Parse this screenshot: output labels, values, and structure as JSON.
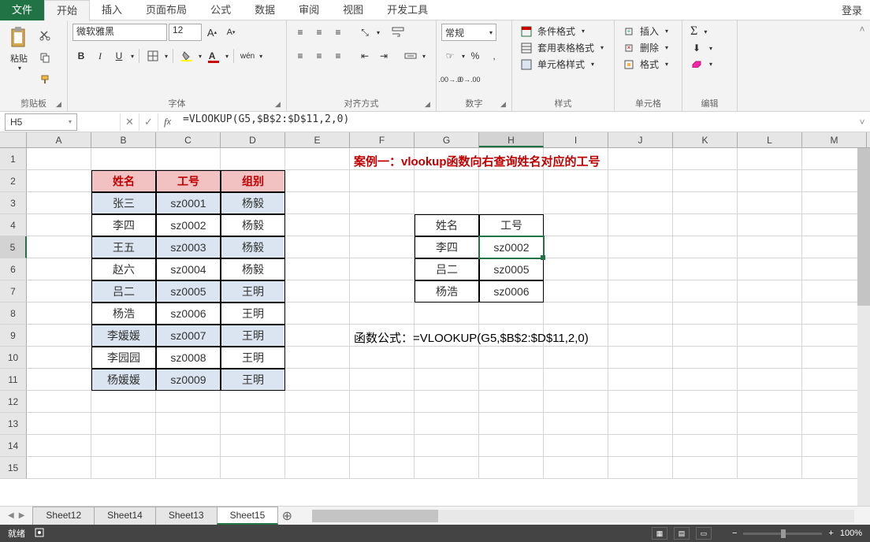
{
  "menu": {
    "file": "文件",
    "tabs": [
      "开始",
      "插入",
      "页面布局",
      "公式",
      "数据",
      "审阅",
      "视图",
      "开发工具"
    ],
    "active": "开始",
    "login": "登录"
  },
  "ribbon": {
    "clipboard": {
      "label": "剪贴板",
      "paste": "粘贴"
    },
    "font": {
      "label": "字体",
      "name": "微软雅黑",
      "size": "12"
    },
    "alignment": {
      "label": "对齐方式"
    },
    "number": {
      "label": "数字",
      "format": "常规"
    },
    "styles": {
      "label": "样式",
      "conditional": "条件格式",
      "table": "套用表格格式",
      "cell": "单元格样式"
    },
    "cells": {
      "label": "单元格",
      "insert": "插入",
      "delete": "删除",
      "format": "格式"
    },
    "editing": {
      "label": "编辑"
    }
  },
  "formula_bar": {
    "cell_ref": "H5",
    "formula": "=VLOOKUP(G5,$B$2:$D$11,2,0)"
  },
  "columns": [
    "A",
    "B",
    "C",
    "D",
    "E",
    "F",
    "G",
    "H",
    "I",
    "J",
    "K",
    "L",
    "M"
  ],
  "row_count": 15,
  "selected_col": "H",
  "selected_row": 5,
  "table1": {
    "headers": [
      "姓名",
      "工号",
      "组别"
    ],
    "rows": [
      [
        "张三",
        "sz0001",
        "杨毅"
      ],
      [
        "李四",
        "sz0002",
        "杨毅"
      ],
      [
        "王五",
        "sz0003",
        "杨毅"
      ],
      [
        "赵六",
        "sz0004",
        "杨毅"
      ],
      [
        "吕二",
        "sz0005",
        "王明"
      ],
      [
        "杨浩",
        "sz0006",
        "王明"
      ],
      [
        "李媛媛",
        "sz0007",
        "王明"
      ],
      [
        "李园园",
        "sz0008",
        "王明"
      ],
      [
        "杨媛媛",
        "sz0009",
        "王明"
      ]
    ]
  },
  "case_title": "案例一：vlookup函数向右查询姓名对应的工号",
  "table2": {
    "headers": [
      "姓名",
      "工号"
    ],
    "rows": [
      [
        "李四",
        "sz0002"
      ],
      [
        "吕二",
        "sz0005"
      ],
      [
        "杨浩",
        "sz0006"
      ]
    ]
  },
  "formula_text": "函数公式：=VLOOKUP(G5,$B$2:$D$11,2,0)",
  "sheets": [
    "Sheet12",
    "Sheet14",
    "Sheet13",
    "Sheet15"
  ],
  "active_sheet": "Sheet15",
  "status": {
    "ready": "就绪",
    "zoom": "100%"
  }
}
